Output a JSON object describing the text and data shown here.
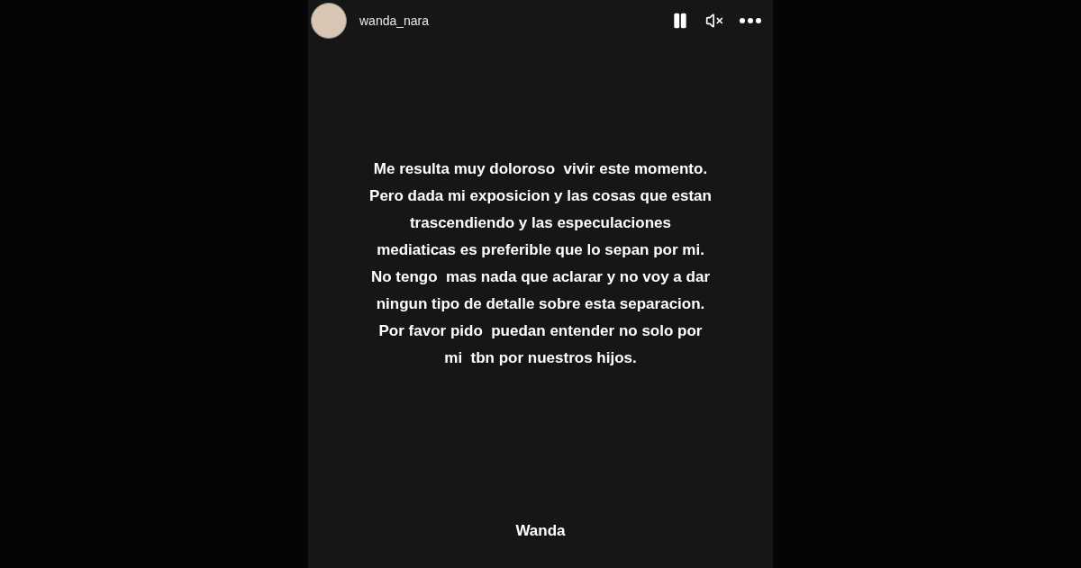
{
  "story": {
    "username": "wanda_nara",
    "message_lines": [
      "Me resulta muy doloroso  vivir este momento.",
      "Pero dada mi exposicion y las cosas que estan",
      "trascendiendo y las especulaciones",
      "mediaticas es preferible que lo sepan por mi.",
      "No tengo  mas nada que aclarar y no voy a dar",
      "ningun tipo de detalle sobre esta separacion.",
      "Por favor pido  puedan entender no solo por",
      "mi  tbn por nuestros hijos."
    ],
    "signature": "Wanda"
  }
}
